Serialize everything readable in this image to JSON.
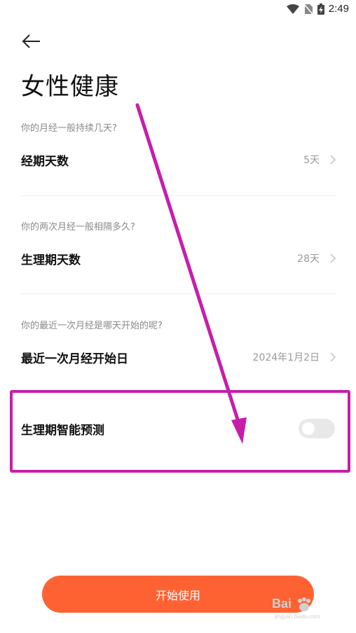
{
  "status_bar": {
    "time": "2:49"
  },
  "title": "女性健康",
  "sections": [
    {
      "hint": "你的月经一般持续几天?",
      "label": "经期天数",
      "value": "5天"
    },
    {
      "hint": "你的两次月经一般相隔多久?",
      "label": "生理期天数",
      "value": "28天"
    },
    {
      "hint": "你的最近一次月经是哪天开始的呢?",
      "label": "最近一次月经开始日",
      "value": "2024年1月2日"
    }
  ],
  "toggle_row": {
    "label": "生理期智能预测",
    "enabled": false
  },
  "start_button": {
    "label": "开始使用"
  },
  "colors": {
    "accent": "#ff6232",
    "annotation": "#c61ea9",
    "hint": "#8a8a8a"
  },
  "watermark": {
    "text": "Bai",
    "sub": "jingyan.baidu.com"
  }
}
